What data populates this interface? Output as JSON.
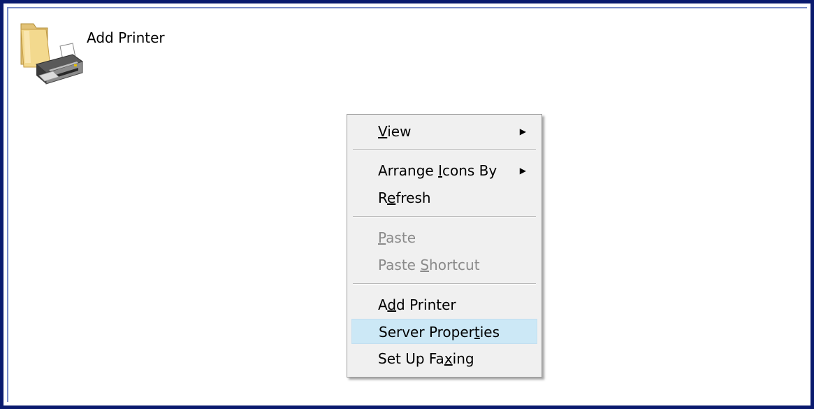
{
  "desktop": {
    "item_label": "Add Printer",
    "icon": "printer-folder-icon"
  },
  "context_menu": {
    "items": [
      {
        "label": "View",
        "accel": "V",
        "submenu": true,
        "enabled": true
      },
      {
        "label": "Arrange Icons By",
        "accel": "I",
        "submenu": true,
        "enabled": true
      },
      {
        "label": "Refresh",
        "accel": "e",
        "submenu": false,
        "enabled": true
      },
      {
        "label": "Paste",
        "accel": "P",
        "submenu": false,
        "enabled": false
      },
      {
        "label": "Paste Shortcut",
        "accel": "S",
        "submenu": false,
        "enabled": false
      },
      {
        "label": "Add Printer",
        "accel": "d",
        "submenu": false,
        "enabled": true
      },
      {
        "label": "Server Properties",
        "accel": "t",
        "submenu": false,
        "enabled": true,
        "highlighted": true
      },
      {
        "label": "Set Up Faxing",
        "accel": "x",
        "submenu": false,
        "enabled": true
      }
    ],
    "submenu_arrow": "▶"
  },
  "colors": {
    "frame_border": "#0a1a6e",
    "menu_background": "#f0f0f0",
    "highlight": "#cce8f6",
    "disabled_text": "#8a8a8a"
  }
}
